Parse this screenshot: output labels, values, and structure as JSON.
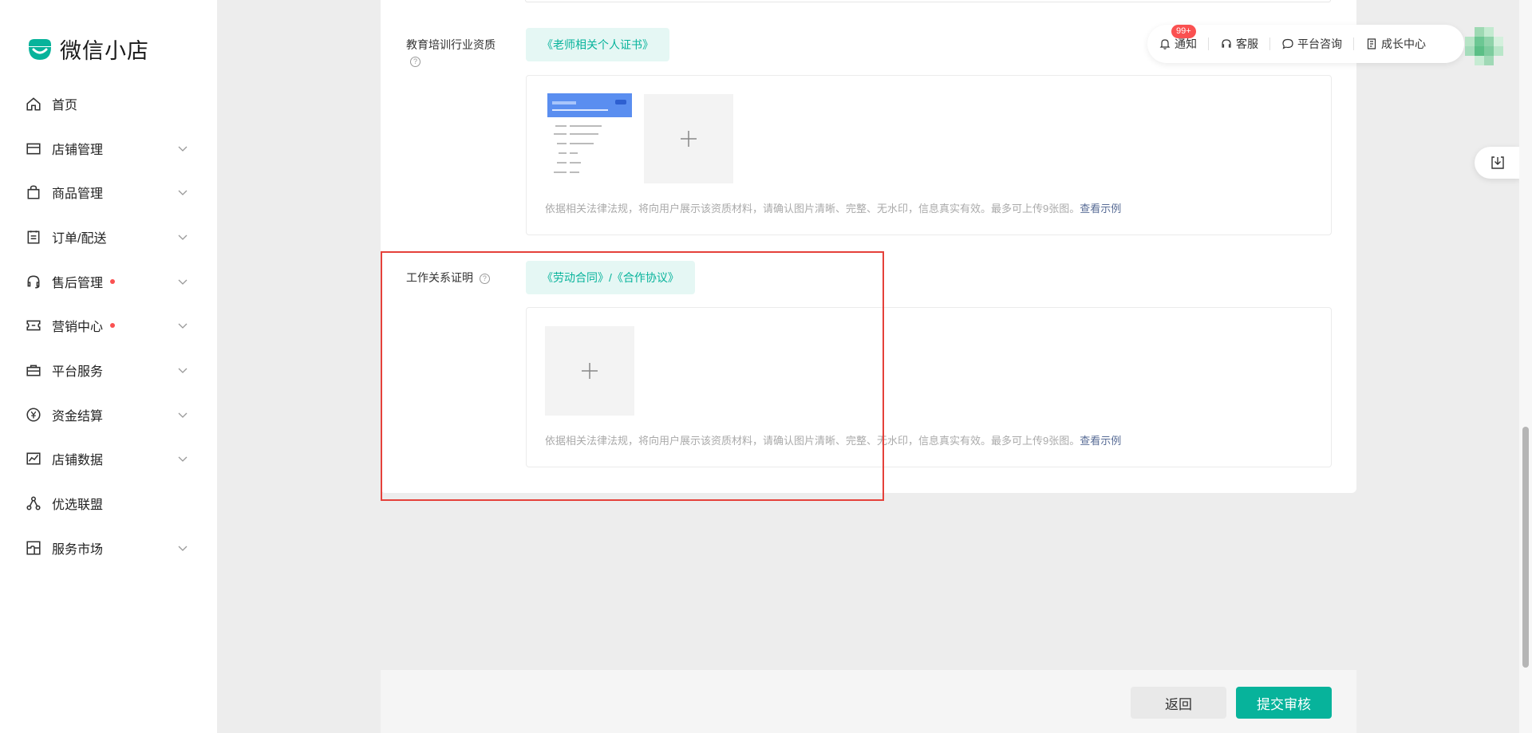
{
  "app": {
    "name": "微信小店"
  },
  "sidebar": {
    "items": [
      {
        "label": "首页",
        "icon": "home-icon",
        "chevron": false,
        "dot": false
      },
      {
        "label": "店铺管理",
        "icon": "store-icon",
        "chevron": true,
        "dot": false
      },
      {
        "label": "商品管理",
        "icon": "shopping-bag-icon",
        "chevron": true,
        "dot": false
      },
      {
        "label": "订单/配送",
        "icon": "clipboard-icon",
        "chevron": true,
        "dot": false
      },
      {
        "label": "售后管理",
        "icon": "headset-icon",
        "chevron": true,
        "dot": true
      },
      {
        "label": "营销中心",
        "icon": "ticket-icon",
        "chevron": true,
        "dot": true
      },
      {
        "label": "平台服务",
        "icon": "briefcase-icon",
        "chevron": true,
        "dot": false
      },
      {
        "label": "资金结算",
        "icon": "yen-icon",
        "chevron": true,
        "dot": false
      },
      {
        "label": "店铺数据",
        "icon": "chart-icon",
        "chevron": true,
        "dot": false
      },
      {
        "label": "优选联盟",
        "icon": "network-icon",
        "chevron": false,
        "dot": false
      },
      {
        "label": "服务市场",
        "icon": "puzzle-icon",
        "chevron": true,
        "dot": false
      }
    ]
  },
  "topbar": {
    "notify": "通知",
    "notify_badge": "99+",
    "service": "客服",
    "consult": "平台咨询",
    "growth": "成长中心"
  },
  "form": {
    "edu": {
      "label": "教育培训行业资质",
      "tag": "《老师相关个人证书》",
      "hint": "依据相关法律法规，将向用户展示该资质材料，请确认图片清晰、完整、无水印，信息真实有效。最多可上传9张图。",
      "example_link": "查看示例"
    },
    "work": {
      "label": "工作关系证明",
      "tag": "《劳动合同》/《合作协议》",
      "hint": "依据相关法律法规，将向用户展示该资质材料，请确认图片清晰、完整、无水印，信息真实有效。最多可上传9张图。",
      "example_link": "查看示例"
    }
  },
  "footer": {
    "back": "返回",
    "submit": "提交审核"
  },
  "colors": {
    "brand": "#07b39b",
    "highlight": "#e5413a",
    "badge": "#fa5151"
  }
}
